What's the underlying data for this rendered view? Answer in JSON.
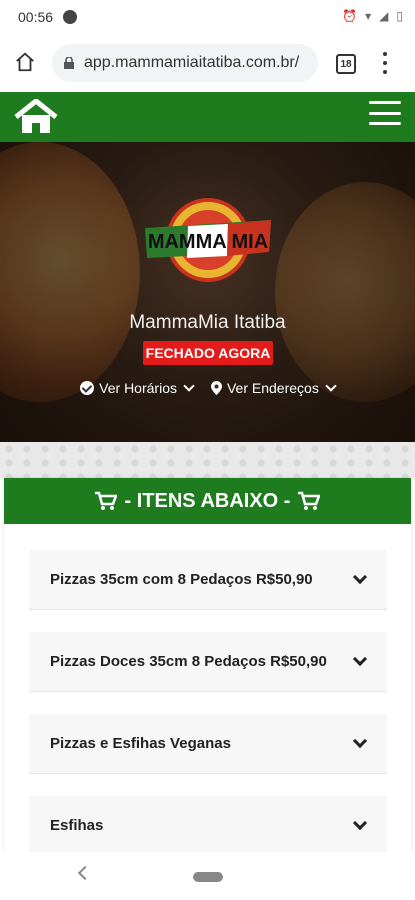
{
  "status_bar": {
    "time": "00:56",
    "right_icons": [
      "alarm-icon",
      "wifi-icon",
      "4g-icon",
      "signal-icon",
      "battery-icon"
    ]
  },
  "browser": {
    "url": "app.mammamiaitatiba.com.br/",
    "tab_count": "18"
  },
  "hero": {
    "logo_text": "MAMMA MIA",
    "brand_name": "MammaMia Itatiba",
    "status": "FECHADO AGORA",
    "links": [
      {
        "label": "Ver Horários",
        "icon": "check-circle-icon"
      },
      {
        "label": "Ver Endereços",
        "icon": "map-pin-icon"
      }
    ]
  },
  "section": {
    "title": "- ITENS ABAIXO -"
  },
  "menu_items": [
    {
      "label": "Pizzas 35cm com 8 Pedaços R$50,90"
    },
    {
      "label": "Pizzas Doces 35cm 8 Pedaços R$50,90"
    },
    {
      "label": "Pizzas e Esfihas Veganas"
    },
    {
      "label": "Esfihas"
    }
  ],
  "colors": {
    "brand_green": "#1e7b1e",
    "closed_red": "#e41b1b"
  }
}
